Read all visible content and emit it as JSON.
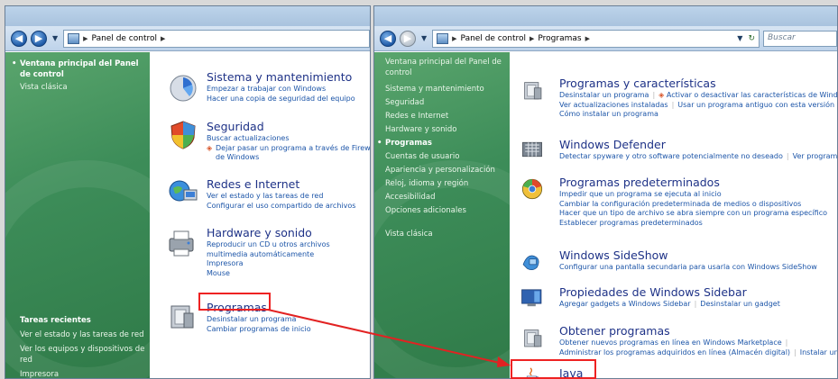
{
  "left_window": {
    "breadcrumb": [
      "Panel de control"
    ],
    "sidebar": {
      "home": "Ventana principal del Panel de control",
      "classic": "Vista clásica",
      "tasks_heading": "Tareas recientes",
      "tasks": [
        "Ver el estado y las tareas de red",
        "Ver los equipos y dispositivos de red",
        "Impresora"
      ]
    },
    "categories": [
      {
        "title": "Sistema y mantenimiento",
        "links": [
          "Empezar a trabajar con Windows",
          "Hacer una copia de seguridad del equipo"
        ]
      },
      {
        "title": "Seguridad",
        "links": [
          "Buscar actualizaciones",
          "Dejar pasar un programa a través de Firewall de Windows"
        ]
      },
      {
        "title": "Redes e Internet",
        "links": [
          "Ver el estado y las tareas de red",
          "Configurar el uso compartido de archivos"
        ]
      },
      {
        "title": "Hardware y sonido",
        "links": [
          "Reproducir un CD u otros archivos multimedia automáticamente",
          "Impresora",
          "Mouse"
        ]
      },
      {
        "title": "Programas",
        "links": [
          "Desinstalar un programa",
          "Cambiar programas de inicio"
        ]
      }
    ]
  },
  "right_window": {
    "breadcrumb": [
      "Panel de control",
      "Programas"
    ],
    "search_placeholder": "Buscar",
    "sidebar": {
      "items": [
        "Ventana principal del Panel de control",
        "Sistema y mantenimiento",
        "Seguridad",
        "Redes e Internet",
        "Hardware y sonido",
        "Programas",
        "Cuentas de usuario",
        "Apariencia y personalización",
        "Reloj, idioma y región",
        "Accesibilidad",
        "Opciones adicionales",
        "Vista clásica"
      ],
      "active_index": 5
    },
    "categories": [
      {
        "title": "Programas y características",
        "links": [
          "Desinstalar un programa",
          "Activar o desactivar las características de Windo",
          "Ver actualizaciones instaladas",
          "Usar un programa antiguo con esta versión de",
          "Cómo instalar un programa"
        ]
      },
      {
        "title": "Windows Defender",
        "links": [
          "Detectar spyware y otro software potencialmente no deseado",
          "Ver programas"
        ]
      },
      {
        "title": "Programas predeterminados",
        "links": [
          "Impedir que un programa se ejecuta al inicio",
          "Cambiar la configuración predeterminada de medios o dispositivos",
          "Hacer que un tipo de archivo se abra siempre con un programa específico",
          "Establecer programas predeterminados"
        ]
      },
      {
        "title": "Windows SideShow",
        "links": [
          "Configurar una pantalla secundaria para usarla con Windows SideShow"
        ]
      },
      {
        "title": "Propiedades de Windows Sidebar",
        "links": [
          "Agregar gadgets a Windows Sidebar",
          "Desinstalar un gadget"
        ]
      },
      {
        "title": "Obtener programas",
        "links": [
          "Obtener nuevos programas en línea en Windows Marketplace",
          "Administrar los programas adquiridos en línea (Almacén digital)",
          "Instalar un"
        ]
      },
      {
        "title": "Java",
        "links": []
      }
    ]
  },
  "colors": {
    "highlight": "#e22222",
    "link": "#1c55a8",
    "title": "#1e3287",
    "sidebar": "#3d8d59"
  }
}
